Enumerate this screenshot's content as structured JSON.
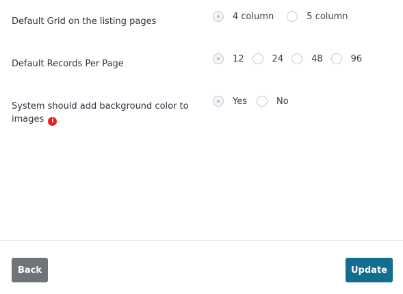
{
  "settings": {
    "grid": {
      "label": "Default Grid on the listing pages",
      "options": [
        "4 column",
        "5 column"
      ],
      "selected": "4 column"
    },
    "records": {
      "label": "Default Records Per Page",
      "options": [
        "12",
        "24",
        "48",
        "96"
      ],
      "selected": "12"
    },
    "background": {
      "label": "System should add background color to images",
      "info_icon": "info-icon",
      "info_glyph": "i",
      "options": [
        "Yes",
        "No"
      ],
      "selected": "Yes"
    }
  },
  "footer": {
    "back_label": "Back",
    "update_label": "Update"
  },
  "colors": {
    "update_button": "#136d8e",
    "back_button": "#6e7479",
    "info_icon": "#e02424"
  }
}
